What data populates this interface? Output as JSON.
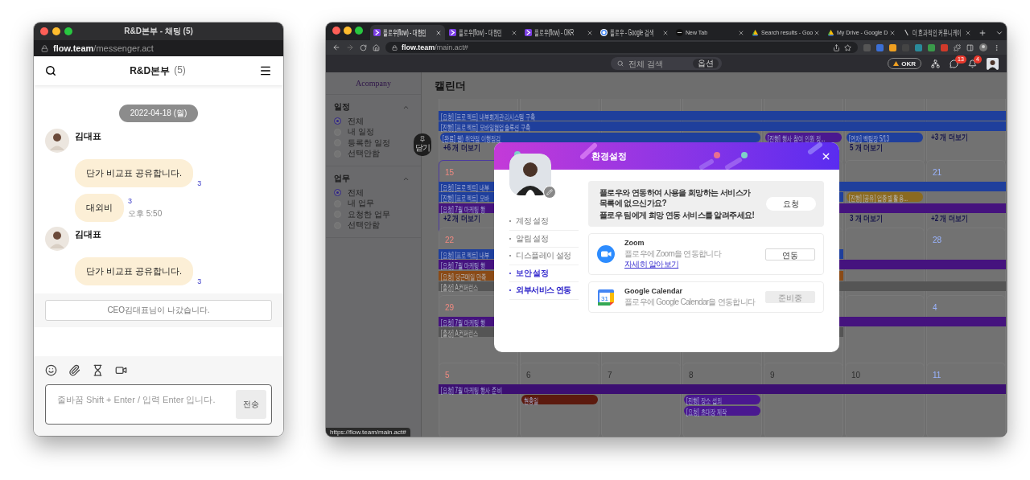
{
  "chat_window": {
    "title": "R&D본부 - 채팅 (5)",
    "url_host": "flow.team",
    "url_path": "/messenger.act",
    "room_name": "R&D본부",
    "member_count": "(5)",
    "date": "2022-04-18 (월)",
    "messages": [
      {
        "kind": "group",
        "sender": "김대표",
        "bubbles": [
          {
            "text": "단가 비교표 공유합니다.",
            "unread": "3"
          },
          {
            "text": "대외비",
            "unread": "3",
            "time": "오후 5:50"
          }
        ]
      },
      {
        "kind": "group",
        "sender": "김대표",
        "bubbles": [
          {
            "text": "단가 비교표 공유합니다.",
            "unread": "3"
          }
        ]
      },
      {
        "kind": "notice",
        "text": "CEO김대표님이 나갔습니다."
      }
    ],
    "composer": {
      "placeholder": "줄바꿈 Shift + Enter / 입력 Enter 입니다.",
      "send": "전송"
    }
  },
  "browser": {
    "tabs": [
      {
        "title": "플로우(flow) - 대한민",
        "selected": true
      },
      {
        "title": "플로우(flow) - 대한민",
        "selected": false
      },
      {
        "title": "플로우(flow) - OKR",
        "selected": false
      },
      {
        "title": "플로우 - Google 검색",
        "selected": false
      },
      {
        "title": "New Tab",
        "selected": false
      },
      {
        "title": "Search results - Goo",
        "selected": false
      },
      {
        "title": "My Drive - Google D",
        "selected": false
      },
      {
        "title": "더 효과적인 커뮤니케이",
        "selected": false
      }
    ],
    "address": {
      "host": "flow.team",
      "path": "/main.act#"
    },
    "app_header": {
      "search_placeholder": "전체 검색",
      "options": "옵션",
      "okr": "OKR",
      "chat_badge": "13",
      "alarm_badge": "4"
    },
    "sidebar": {
      "logo": "Acompany",
      "collapse": "닫기",
      "sections": [
        {
          "title": "일정",
          "expanded": true,
          "options": [
            {
              "label": "전체",
              "selected": true
            },
            {
              "label": "내 일정",
              "selected": false
            },
            {
              "label": "등록한 일정",
              "selected": false
            },
            {
              "label": "선택안함",
              "selected": false
            }
          ]
        },
        {
          "title": "업무",
          "expanded": true,
          "options": [
            {
              "label": "전체",
              "selected": true
            },
            {
              "label": "내 업무",
              "selected": false
            },
            {
              "label": "요청한 업무",
              "selected": false
            },
            {
              "label": "선택안함",
              "selected": false
            }
          ]
        }
      ]
    },
    "calendar": {
      "title": "캘린더",
      "weeks": [
        {
          "lanes": [
            [
              {
                "text": "[요청] [프로젝트] 내부회계관리시스템 구축",
                "color": "#1f3f9c"
              }
            ],
            [
              {
                "text": "[진행] [프로젝트] 모바일협업솔루션 구축",
                "color": "#1f3f9c"
              }
            ],
            [
              {
                "text": "[완료] 웹) 취약점 이행점검",
                "color": "#1f3f9c"
              },
              {
                "text": "[진행] 행사 참여 인원 정...",
                "color": "#4a1890"
              },
              {
                "text": "[연차] 백팀장 5/13",
                "color": "#1f3f9c"
              }
            ]
          ],
          "more": [
            "+6 개 더보기",
            "5 개 더보기",
            "+3 개 더보기"
          ]
        },
        {
          "days": [
            {
              "label": "15",
              "today": true
            },
            {
              "label": "21",
              "today": false
            }
          ],
          "lanes": [
            [
              {
                "text": "[요청] [프로젝트] 내부",
                "color": "#1f3f9c"
              }
            ],
            [
              {
                "text": "[진행] [프로젝트] 모바",
                "color": "#1f3f9c"
              },
              {
                "text": "[진행] [공유] 업종별 활용...",
                "color": "#8a6a20"
              }
            ],
            [
              {
                "text": "[요청] 7월 마케팅 행",
                "color": "#45137e"
              }
            ]
          ],
          "more": [
            "+2 개 더보기",
            "3 개 더보기",
            "+2 개 더보기"
          ]
        },
        {
          "days": [
            {
              "label": "22",
              "today": false
            },
            {
              "label": "28",
              "today": false
            }
          ],
          "lanes": [
            [
              {
                "text": "[요청] [프로젝트] 내부",
                "color": "#1f3f9c"
              }
            ],
            [
              {
                "text": "[요청] 7월 마케팅 행",
                "color": "#45137e"
              }
            ],
            [
              {
                "text": "[요청] 당근메일 만족",
                "color": "#8a4a16"
              }
            ],
            [
              {
                "text": "[출장] A컨퍼런스",
                "color": "#555555"
              }
            ]
          ]
        },
        {
          "days": [
            {
              "label": "29",
              "today": false
            },
            {
              "label": "4",
              "today": false
            }
          ],
          "lanes": [
            [
              {
                "text": "[요청] 7월 마케팅 행",
                "color": "#45137e"
              }
            ],
            [
              {
                "text": "[출장] A컨퍼런스",
                "color": "#555555"
              }
            ]
          ]
        },
        {
          "days": [
            {
              "label": "5",
              "today": false
            },
            {
              "label": "6",
              "today": false
            },
            {
              "label": "7",
              "today": false
            },
            {
              "label": "8",
              "today": false
            },
            {
              "label": "9",
              "today": false
            },
            {
              "label": "10",
              "today": false
            },
            {
              "label": "11",
              "today": false
            }
          ],
          "lanes": [
            [
              {
                "text": "[요청] 7월 마케팅 행사 준비",
                "color": "#3c0f72"
              }
            ],
            [
              {
                "text": "현충일",
                "color": "#5c1a0e"
              },
              {
                "text": "[진행] 장소 섭외",
                "color": "#4a1890"
              }
            ],
            [
              {
                "text": "[요청] 초대장 제작",
                "color": "#4a1890"
              }
            ]
          ]
        }
      ]
    },
    "modal": {
      "title": "환경설정",
      "menu": [
        {
          "label": "계정 설정",
          "selected": false,
          "hovered": false
        },
        {
          "label": "알림 설정",
          "selected": false,
          "hovered": false
        },
        {
          "label": "디스플레이 설정",
          "selected": false,
          "hovered": false
        },
        {
          "label": "보안 설정",
          "selected": false,
          "hovered": true
        },
        {
          "label": "외부서비스 연동",
          "selected": true,
          "hovered": false
        }
      ],
      "request": {
        "lines": [
          "플로우와 연동하여 사용을 희망하는 서비스가 목록에 없으신가요?",
          "플로우 팀에게 희망 연동 서비스를 알려주세요!"
        ],
        "button": "요청"
      },
      "services": [
        {
          "kind": "zoom",
          "name": "Zoom",
          "description": "플로우에 Zoom을 연동합니다",
          "link": "자세히 알아보기",
          "button": "연동",
          "disabled": false
        },
        {
          "kind": "google_calendar",
          "icon_label": "31",
          "name": "Google Calendar",
          "description": "플로우에 Google Calendar을 연동합니다",
          "button": "준비중",
          "disabled": true
        }
      ]
    },
    "status_url": "https://flow.team/main.act#"
  }
}
